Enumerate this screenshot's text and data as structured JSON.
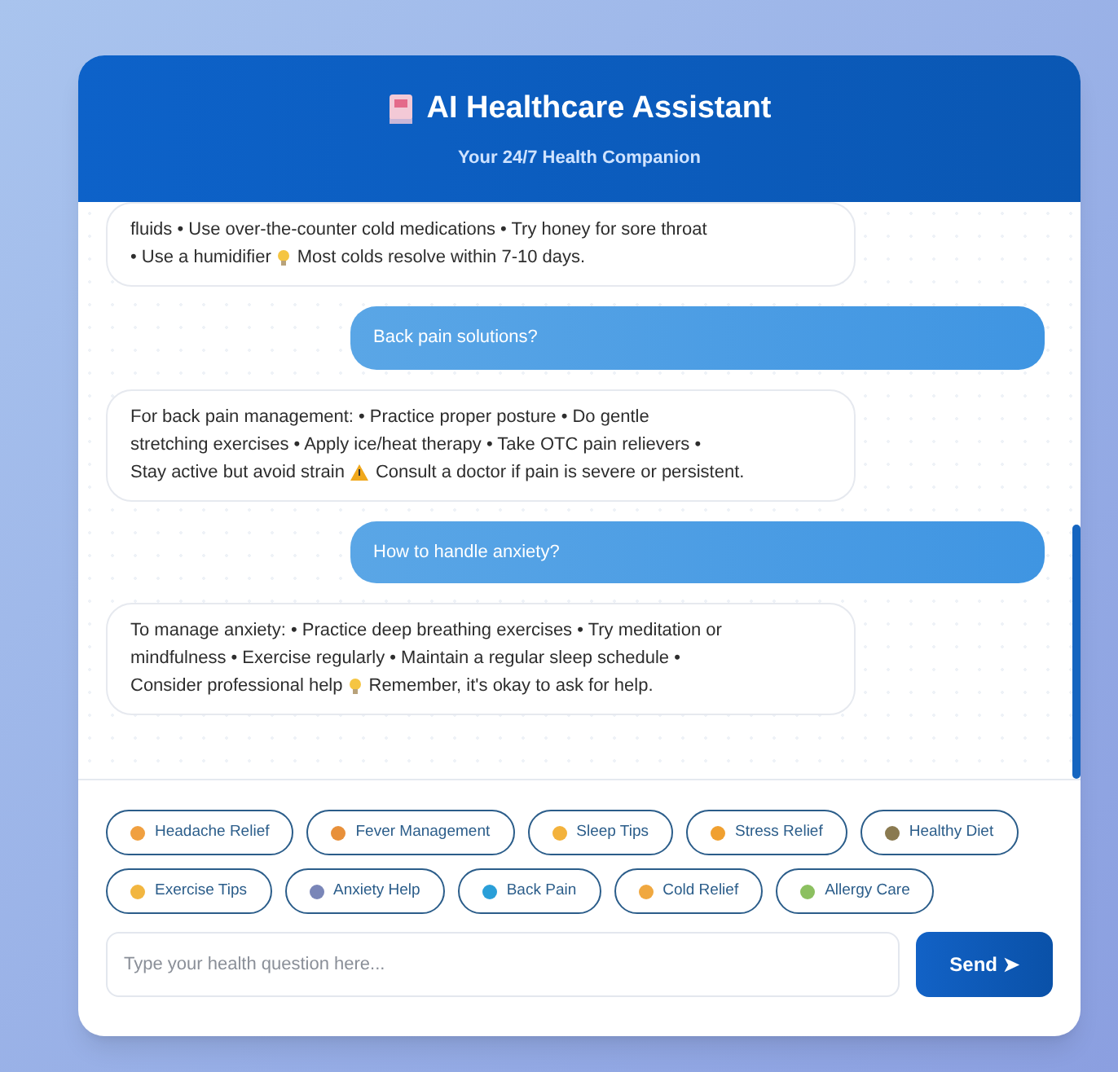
{
  "header": {
    "title": "AI Healthcare Assistant",
    "subtitle": "Your 24/7 Health Companion"
  },
  "messages": [
    {
      "kind": "bot",
      "lines": [
        [
          {
            "kind": "text",
            "text": "fluids • Use over-the-counter cold medications • Try honey for sore throat"
          }
        ],
        [
          {
            "kind": "text",
            "text": "• Use a humidifier"
          },
          {
            "kind": "bulb"
          },
          {
            "kind": "text",
            "text": "Most colds resolve within 7-10 days."
          }
        ]
      ]
    },
    {
      "kind": "user",
      "lines": [
        [
          {
            "kind": "text",
            "text": "Back pain solutions?"
          }
        ]
      ]
    },
    {
      "kind": "bot",
      "lines": [
        [
          {
            "kind": "text",
            "text": "For back pain management: • Practice proper posture • Do gentle"
          }
        ],
        [
          {
            "kind": "text",
            "text": "stretching exercises • Apply ice/heat therapy • Take OTC pain relievers •"
          }
        ],
        [
          {
            "kind": "text",
            "text": "Stay active but avoid strain"
          },
          {
            "kind": "warning"
          },
          {
            "kind": "text",
            "text": "Consult a doctor if pain is severe or persistent."
          }
        ]
      ]
    },
    {
      "kind": "user",
      "lines": [
        [
          {
            "kind": "text",
            "text": "How to handle anxiety?"
          }
        ]
      ]
    },
    {
      "kind": "bot",
      "lines": [
        [
          {
            "kind": "text",
            "text": "To manage anxiety: • Practice deep breathing exercises • Try meditation or"
          }
        ],
        [
          {
            "kind": "text",
            "text": "mindfulness • Exercise regularly • Maintain a regular sleep schedule •"
          }
        ],
        [
          {
            "kind": "text",
            "text": "Consider professional help"
          },
          {
            "kind": "bulb"
          },
          {
            "kind": "text",
            "text": "Remember, it's okay to ask for help."
          }
        ]
      ]
    }
  ],
  "quick_replies": [
    "Headache Relief",
    "Fever Management",
    "Sleep Tips",
    "Stress Relief",
    "Healthy Diet",
    "Exercise Tips",
    "Anxiety Help",
    "Back Pain",
    "Cold Relief",
    "Allergy Care"
  ],
  "input": {
    "placeholder": "Type your health question here..."
  },
  "send_button": {
    "label": "Send ➤"
  }
}
